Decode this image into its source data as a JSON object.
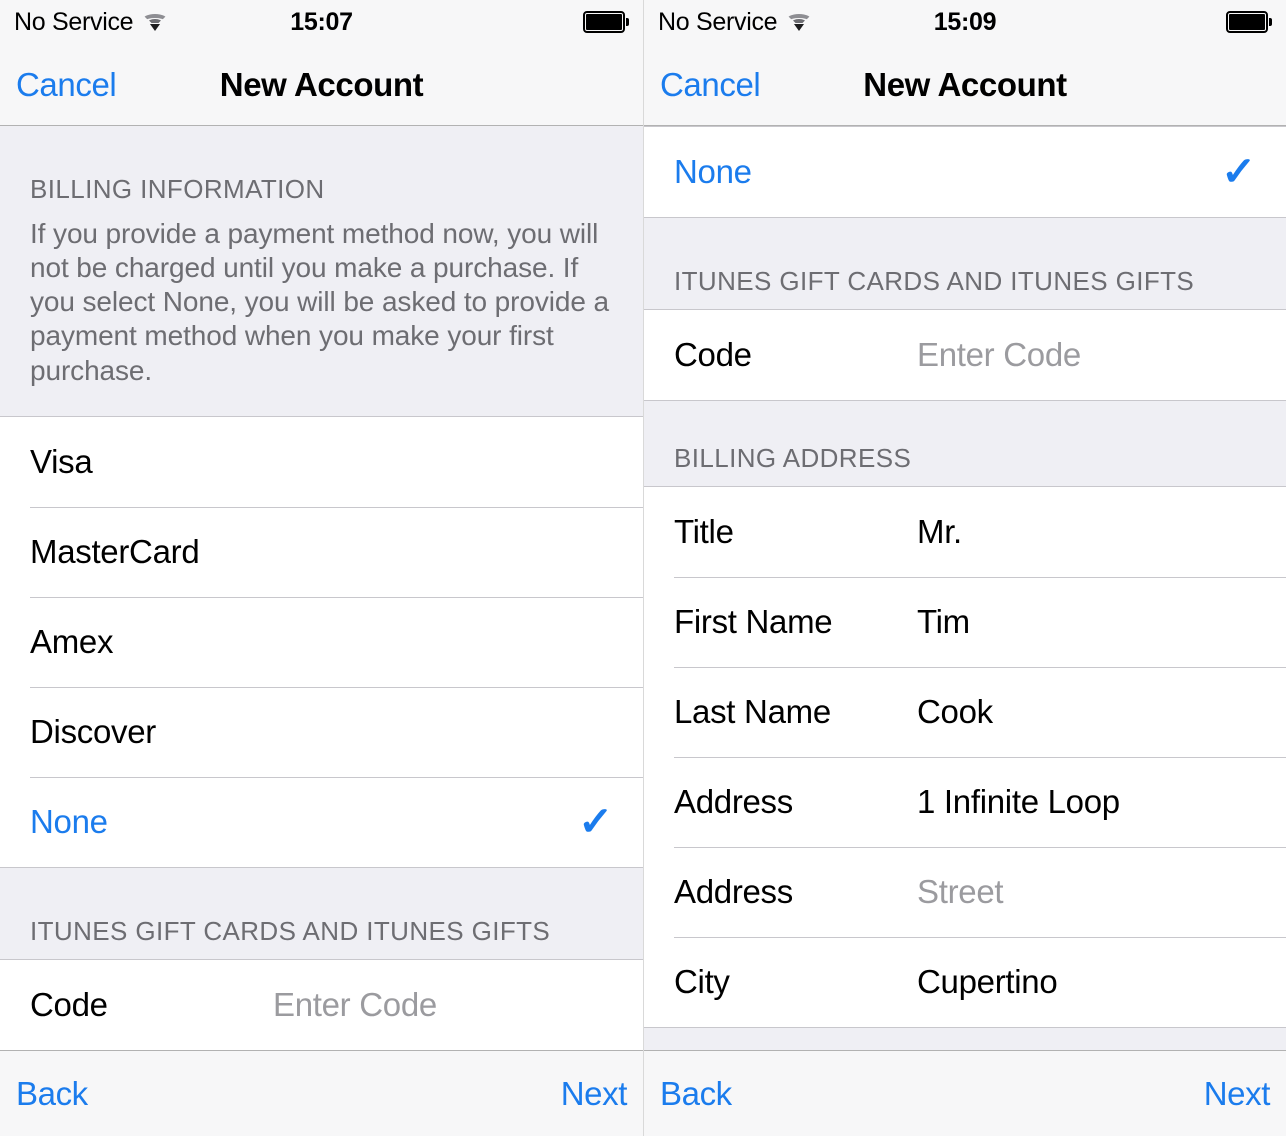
{
  "screens": [
    {
      "id": "left",
      "status": {
        "carrier": "No Service",
        "wifi_icon": "wifi-icon",
        "time": "15:07",
        "battery_icon": "battery-full-icon"
      },
      "nav": {
        "cancel": "Cancel",
        "title": "New Account"
      },
      "billing_section": {
        "header": "BILLING INFORMATION",
        "footer": "If you provide a payment method now, you will not be charged until you make a purchase. If you select None, you will be asked to provide a payment method when you make your first purchase.",
        "options": [
          {
            "label": "Visa",
            "selected": false
          },
          {
            "label": "MasterCard",
            "selected": false
          },
          {
            "label": "Amex",
            "selected": false
          },
          {
            "label": "Discover",
            "selected": false
          },
          {
            "label": "None",
            "selected": true
          }
        ]
      },
      "gift_section": {
        "header": "ITUNES GIFT CARDS AND ITUNES GIFTS",
        "code_label": "Code",
        "code_placeholder": "Enter Code",
        "code_value": ""
      },
      "toolbar": {
        "back": "Back",
        "next": "Next"
      }
    },
    {
      "id": "right",
      "status": {
        "carrier": "No Service",
        "wifi_icon": "wifi-icon",
        "time": "15:09",
        "battery_icon": "battery-full-icon"
      },
      "nav": {
        "cancel": "Cancel",
        "title": "New Account"
      },
      "none_row": {
        "label": "None",
        "selected": true
      },
      "gift_section": {
        "header": "ITUNES GIFT CARDS AND ITUNES GIFTS",
        "code_label": "Code",
        "code_placeholder": "Enter Code",
        "code_value": ""
      },
      "address_section": {
        "header": "BILLING ADDRESS",
        "fields": [
          {
            "label": "Title",
            "value": "Mr.",
            "placeholder": ""
          },
          {
            "label": "First Name",
            "value": "Tim",
            "placeholder": ""
          },
          {
            "label": "Last Name",
            "value": "Cook",
            "placeholder": ""
          },
          {
            "label": "Address",
            "value": "1 Infinite Loop",
            "placeholder": ""
          },
          {
            "label": "Address",
            "value": "",
            "placeholder": "Street"
          },
          {
            "label": "City",
            "value": "Cupertino",
            "placeholder": ""
          }
        ]
      },
      "toolbar": {
        "back": "Back",
        "next": "Next"
      }
    }
  ],
  "colors": {
    "accent": "#1b7ced",
    "group_bg": "#efeff4",
    "separator": "#c8c7cc",
    "bar_bg": "#f7f7f8",
    "muted_text": "#6d6d72"
  }
}
